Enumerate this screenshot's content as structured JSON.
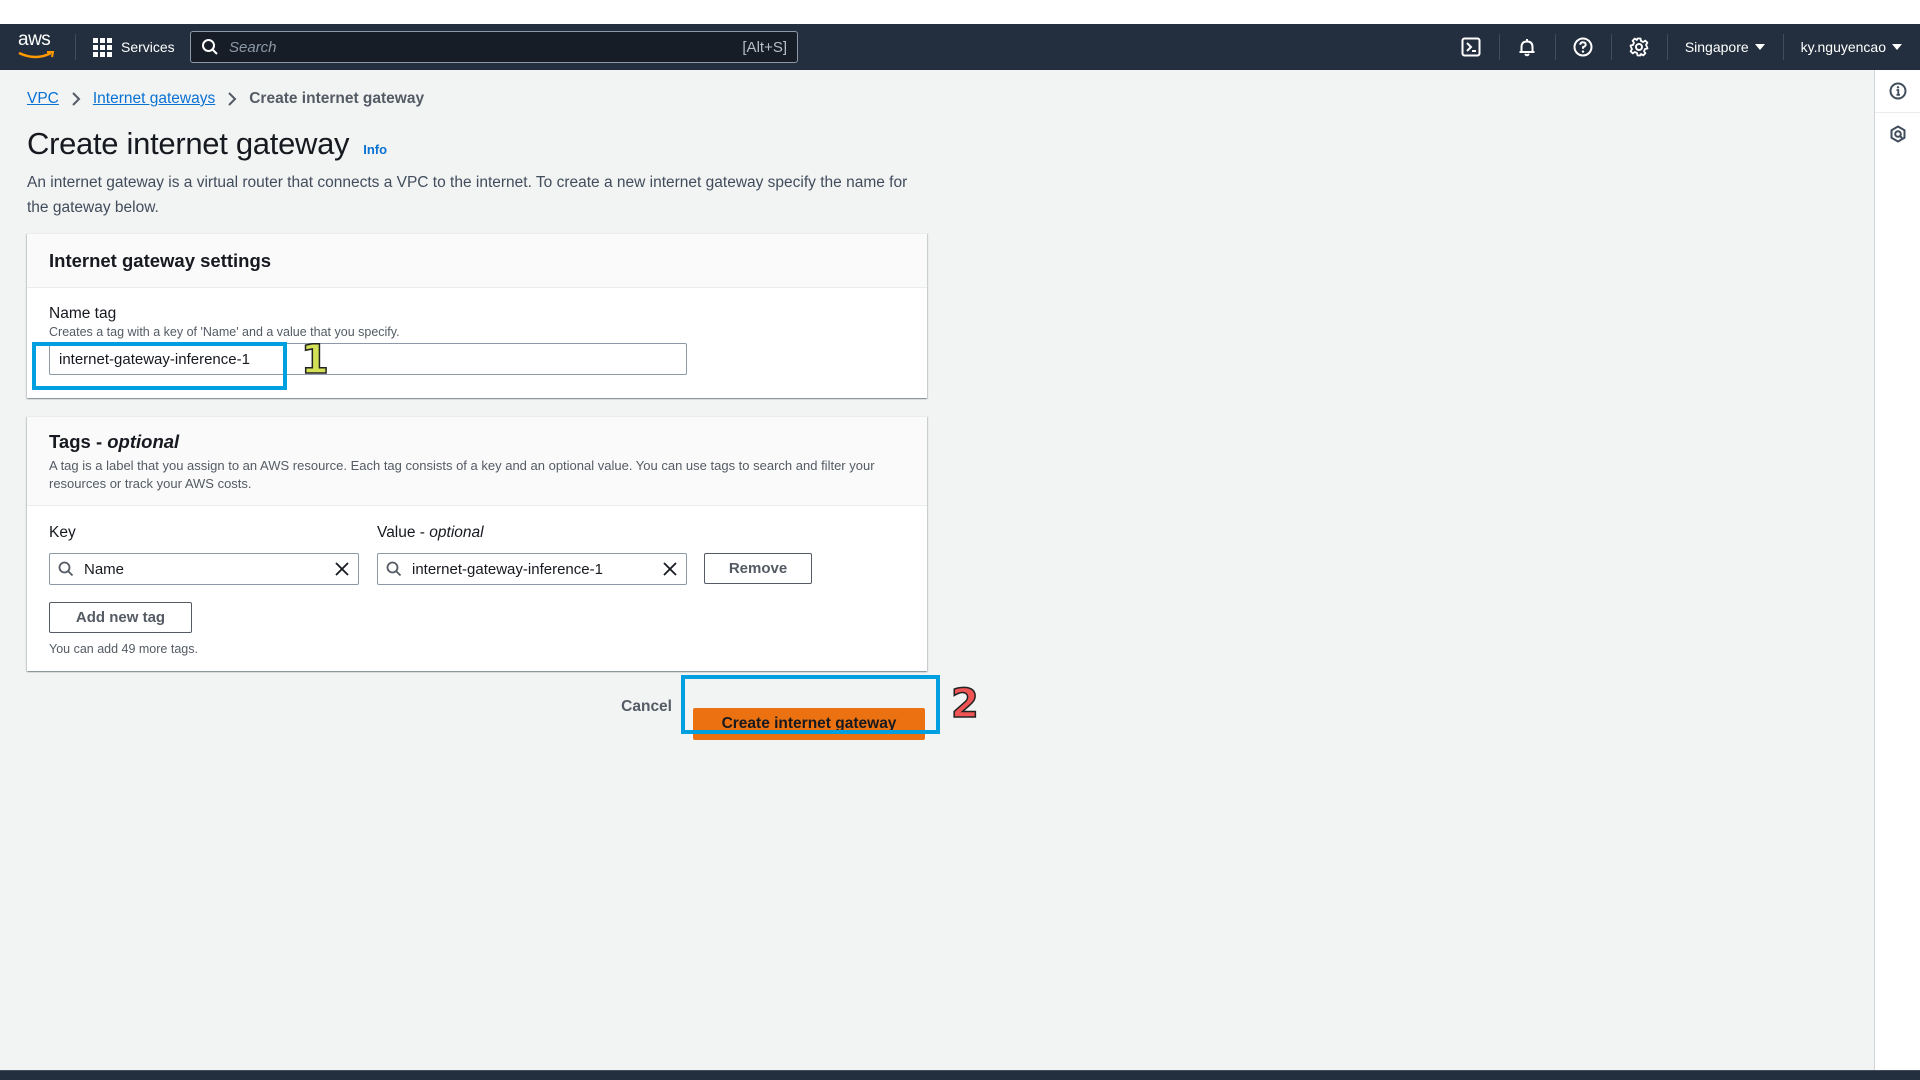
{
  "nav": {
    "logo_text": "aws",
    "services_label": "Services",
    "search_placeholder": "Search",
    "search_shortcut": "[Alt+S]",
    "icons": [
      "cloudshell-icon",
      "bell-icon",
      "help-icon",
      "gear-icon"
    ],
    "region": "Singapore",
    "user": "ky.nguyencao"
  },
  "side_panel": {
    "icons": [
      "info-icon",
      "feedback-icon"
    ]
  },
  "breadcrumb": {
    "items": [
      {
        "label": "VPC",
        "link": true
      },
      {
        "label": "Internet gateways",
        "link": true
      },
      {
        "label": "Create internet gateway",
        "link": false
      }
    ]
  },
  "page": {
    "title": "Create internet gateway",
    "info_label": "Info",
    "description": "An internet gateway is a virtual router that connects a VPC to the internet. To create a new internet gateway specify the name for the gateway below."
  },
  "settings": {
    "header": "Internet gateway settings",
    "name_tag_label": "Name tag",
    "name_tag_desc": "Creates a tag with a key of 'Name' and a value that you specify.",
    "name_tag_value": "internet-gateway-inference-1"
  },
  "tags": {
    "header_main": "Tags - ",
    "header_optional": "optional",
    "description": "A tag is a label that you assign to an AWS resource. Each tag consists of a key and an optional value. You can use tags to search and filter your resources or track your AWS costs.",
    "key_label": "Key",
    "value_label_main": "Value - ",
    "value_label_optional": "optional",
    "rows": [
      {
        "key": "Name",
        "value": "internet-gateway-inference-1"
      }
    ],
    "remove_label": "Remove",
    "add_label": "Add new tag",
    "hint": "You can add 49 more tags."
  },
  "actions": {
    "cancel_label": "Cancel",
    "create_label": "Create internet gateway"
  },
  "annotations": [
    {
      "number": "1",
      "color": "#d4e157"
    },
    {
      "number": "2",
      "color": "#f05454"
    }
  ],
  "colors": {
    "nav_bg": "#232f3e",
    "primary_button": "#ec7211",
    "link": "#0972d3",
    "annotation_box": "#00a0e0"
  }
}
